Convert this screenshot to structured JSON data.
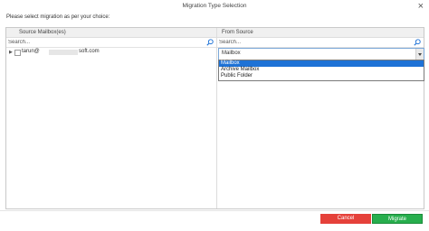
{
  "window": {
    "title": "Migration Type Selection",
    "close_glyph": "×"
  },
  "instruction": "Please select migration as per your choice:",
  "columns": {
    "source_header": "Source Mailbox(es)",
    "from_header": "From Source"
  },
  "search": {
    "left_placeholder": "Search...",
    "right_placeholder": "Search..."
  },
  "mailbox": {
    "expander": "▶",
    "user": "tarun@",
    "domain": "soft.com"
  },
  "select": {
    "value": "Mailbox",
    "options": [
      "Mailbox",
      "Archive Mailbox",
      "Public Folder"
    ],
    "selected_index": 0
  },
  "buttons": {
    "cancel": "Cancel",
    "migrate": "Migrate"
  },
  "colors": {
    "cancel": "#e5413a",
    "migrate": "#27ae4d",
    "highlight": "#1e72d6"
  }
}
